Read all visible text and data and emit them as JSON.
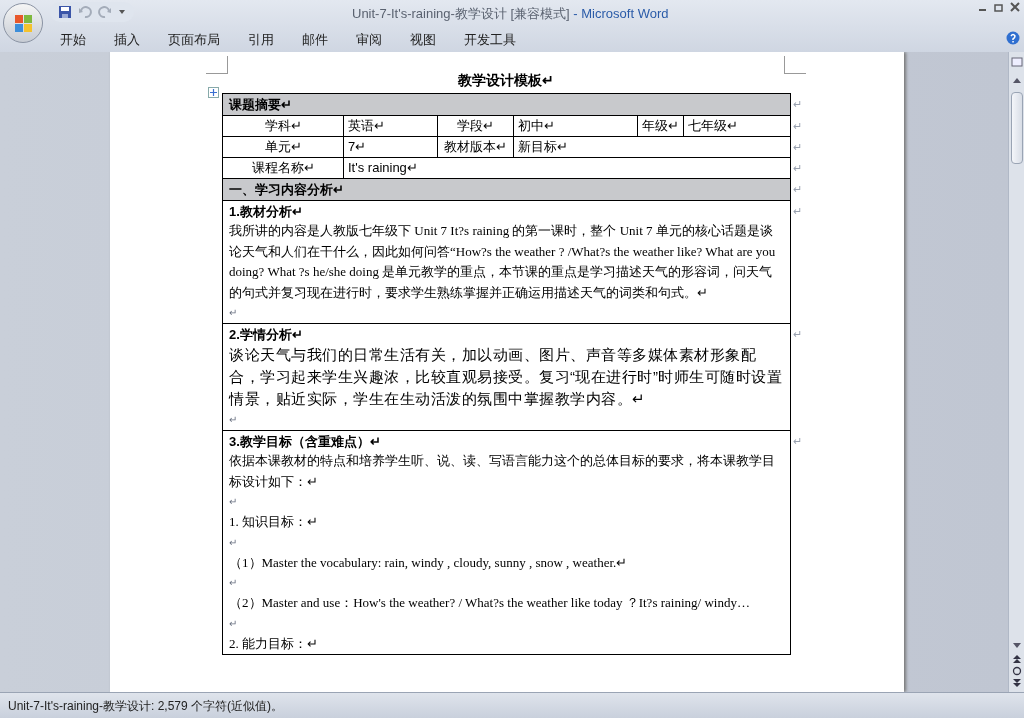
{
  "window": {
    "title": "Unit-7-It's-raining-教学设计 [兼容模式]",
    "app": " - Microsoft Word"
  },
  "ribbon_tabs": [
    {
      "label": "开始",
      "selected": false
    },
    {
      "label": "插入",
      "selected": false
    },
    {
      "label": "页面布局",
      "selected": false
    },
    {
      "label": "引用",
      "selected": false
    },
    {
      "label": "邮件",
      "selected": false
    },
    {
      "label": "审阅",
      "selected": false
    },
    {
      "label": "视图",
      "selected": false
    },
    {
      "label": "开发工具",
      "selected": false
    }
  ],
  "document": {
    "heading": "教学设计模板↵",
    "row_end_mark": "↵",
    "table": [
      {
        "kind": "header",
        "text": "课题摘要↵"
      },
      {
        "kind": "cells",
        "cells": [
          {
            "text": "学科↵"
          },
          {
            "text": "英语↵"
          },
          {
            "text": "学段↵"
          },
          {
            "text": "初中↵"
          },
          {
            "text": "年级↵"
          },
          {
            "text": "七年级↵"
          }
        ]
      },
      {
        "kind": "cells",
        "cells": [
          {
            "text": "单元↵"
          },
          {
            "text": "7↵"
          },
          {
            "text": "教材版本↵"
          },
          {
            "text": "新目标↵"
          }
        ]
      },
      {
        "kind": "cells",
        "cells": [
          {
            "text": "课程名称↵"
          },
          {
            "text": "It's raining↵"
          }
        ]
      },
      {
        "kind": "header",
        "text": "一、学习内容分析↵"
      },
      {
        "kind": "section",
        "title": "1.教材分析↵",
        "lines": [
          {
            "kind": "para",
            "text": "我所讲的内容是人教版七年级下 Unit 7 It?s raining 的第一课时，整个 Unit 7 单元的核心话题是谈论天气和人们在干什么，因此如何问答“How?s the weather ? /What?s the weather like? What are you doing? What ?s he/she doing  是单元教学的重点，本节课的重点是学习描述天气的形容词，问天气的句式并复习现在进行时，要求学生熟练掌握并正确运用描述天气的词类和句式。↵"
          },
          {
            "kind": "mark",
            "text": "↵"
          }
        ]
      },
      {
        "kind": "section",
        "title": "2.学情分析↵",
        "lines": [
          {
            "kind": "big",
            "text": "谈论天气与我们的日常生活有关，加以动画、图片、声音等多媒体素材形象配合，学习起来学生兴趣浓，比较直观易接受。复习“现在进行时”时师生可随时设置情景，贴近实际，学生在生动活泼的氛围中掌握教学内容。↵"
          },
          {
            "kind": "mark",
            "text": "↵"
          }
        ]
      },
      {
        "kind": "section",
        "title": "3.教学目标（含重难点）↵",
        "lines": [
          {
            "kind": "para",
            "text": "依据本课教材的特点和培养学生听、说、读、写语言能力这个的总体目标的要求，将本课教学目标设计如下：↵"
          },
          {
            "kind": "mark",
            "text": "↵"
          },
          {
            "kind": "para",
            "text": "1. 知识目标：↵"
          },
          {
            "kind": "mark",
            "text": "↵"
          },
          {
            "kind": "para",
            "text": "（1）Master the vocabulary: rain, windy , cloudy, sunny , snow , weather.↵"
          },
          {
            "kind": "mark",
            "text": "↵"
          },
          {
            "kind": "para",
            "text": "（2）Master and use：How's the weather? / What?s the weather like today  ？It?s raining/ windy…"
          },
          {
            "kind": "mark",
            "text": "↵"
          },
          {
            "kind": "para",
            "text": "2. 能力目标：↵"
          }
        ]
      }
    ]
  },
  "status_bar": "Unit-7-It's-raining-教学设计: 2,579 个字符(近似值)。"
}
